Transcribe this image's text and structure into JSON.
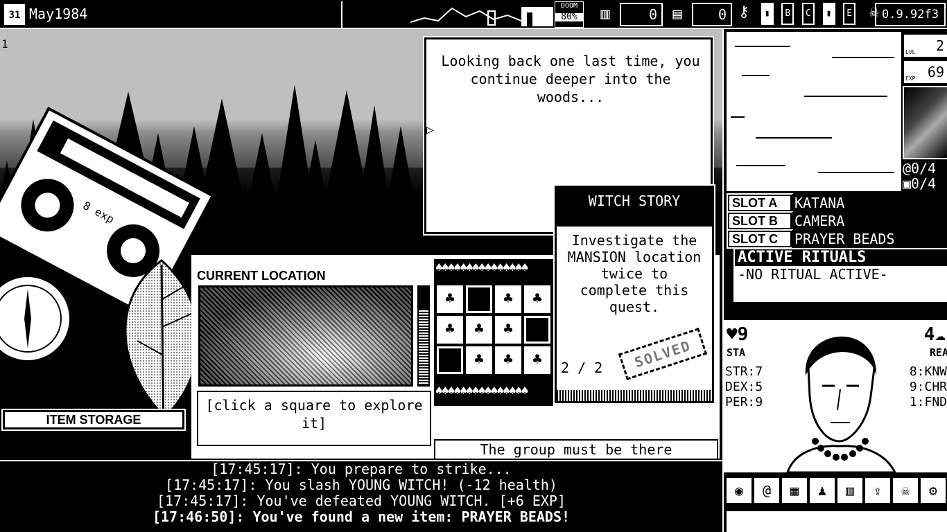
{
  "topbar": {
    "date_icon": "31",
    "date": "May1984",
    "doom_label": "DOOM",
    "doom_value": "80%",
    "funds": "0",
    "ammo": "0",
    "keys": [
      "B",
      "C",
      "E"
    ],
    "version": "0.9.92f3"
  },
  "scene": {
    "marker": "1",
    "story_text": "Looking back one last time, you continue deeper into the woods...",
    "quest": {
      "title": "WITCH STORY",
      "description": "Investigate the MANSION location twice to complete this quest.",
      "progress": "2 / 2",
      "stamp": "SOLVED"
    },
    "location": {
      "heading": "CURRENT LOCATION",
      "explore_hint": "[click a square to explore it]",
      "group_message": "The group must be there somewhere...",
      "grid": [
        [
          "tree",
          "dark",
          "tree",
          "tree"
        ],
        [
          "tree",
          "tree",
          "tree",
          "dark"
        ],
        [
          "dark",
          "tree",
          "tree",
          "tree"
        ]
      ]
    },
    "item_storage": "ITEM STORAGE",
    "cassette_label": "8 exp"
  },
  "log": [
    {
      "text": "[17:45:17]: You prepare to strike...",
      "bold": false
    },
    {
      "text": "[17:45:17]: You slash YOUNG WITCH! (-12 health)",
      "bold": false
    },
    {
      "text": "[17:45:17]: You've defeated YOUNG WITCH. [+6 EXP]",
      "bold": false
    },
    {
      "text": "[17:46:50]: You've found a new item: PRAYER BEADS!",
      "bold": true
    }
  ],
  "right": {
    "lvl_label": "LVL",
    "lvl": "2",
    "exp_label": "EXP",
    "exp": "69",
    "spell_count": "0/4",
    "item_count": "0/4",
    "slots": [
      {
        "label": "SLOT A",
        "value": "KATANA"
      },
      {
        "label": "SLOT B",
        "value": "CAMERA"
      },
      {
        "label": "SLOT C",
        "value": "PRAYER BEADS"
      }
    ],
    "rituals_title": "ACTIVE RITUALS",
    "rituals_value": "-NO RITUAL ACTIVE-",
    "stamina": "9",
    "stamina_label": "STA",
    "reason": "4",
    "reason_label": "REA",
    "stats_left": [
      "STR:7",
      "DEX:5",
      "PER:9"
    ],
    "stats_right": [
      "8:KNW",
      "9:CHR",
      "1:FND"
    ]
  },
  "colors": {
    "fg": "#ffffff",
    "bg": "#000000"
  }
}
